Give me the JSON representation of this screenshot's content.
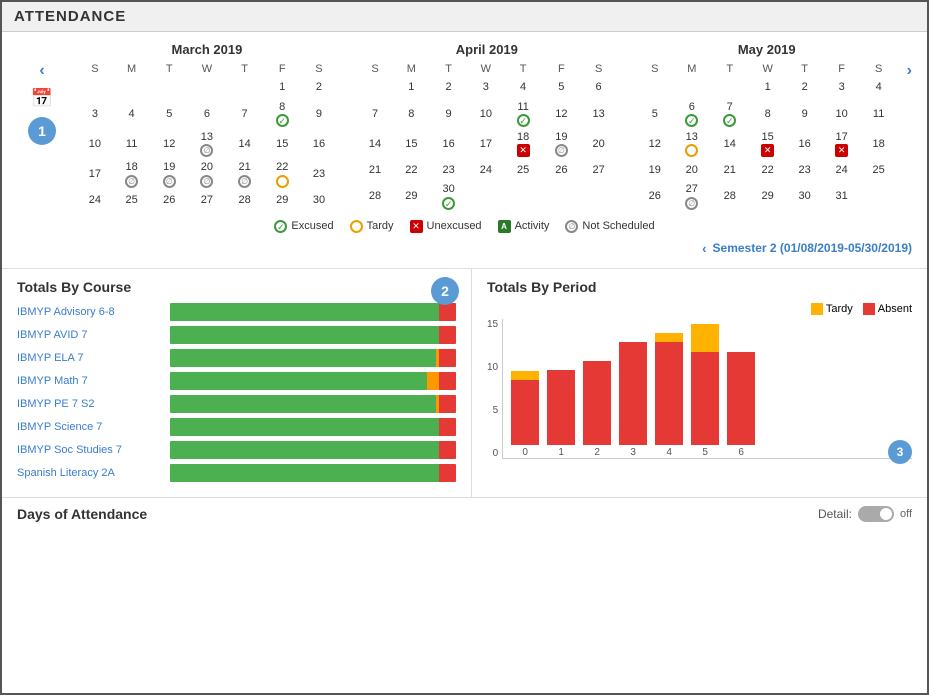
{
  "header": {
    "title": "ATTENDANCE"
  },
  "calendar": {
    "months": [
      {
        "title": "March 2019",
        "headers": [
          "S",
          "M",
          "T",
          "W",
          "T",
          "F",
          "S"
        ],
        "weeks": [
          [
            {
              "day": "",
              "other": true
            },
            {
              "day": "",
              "other": true
            },
            {
              "day": "",
              "other": true
            },
            {
              "day": "",
              "other": true
            },
            {
              "day": "",
              "other": true
            },
            {
              "day": "1"
            },
            {
              "day": "2"
            }
          ],
          [
            {
              "day": "3"
            },
            {
              "day": "4"
            },
            {
              "day": "5"
            },
            {
              "day": "6"
            },
            {
              "day": "7"
            },
            {
              "day": "8",
              "icon": "excused"
            },
            {
              "day": "9"
            }
          ],
          [
            {
              "day": "10"
            },
            {
              "day": "11"
            },
            {
              "day": "12"
            },
            {
              "day": "13",
              "icon": "notscheduled"
            },
            {
              "day": "14"
            },
            {
              "day": "15"
            },
            {
              "day": "16"
            }
          ],
          [
            {
              "day": "17"
            },
            {
              "day": "18",
              "icon": "notscheduled"
            },
            {
              "day": "19",
              "icon": "notscheduled"
            },
            {
              "day": "20",
              "icon": "notscheduled"
            },
            {
              "day": "21",
              "icon": "notscheduled"
            },
            {
              "day": "22",
              "icon": "tardy"
            },
            {
              "day": "23"
            }
          ],
          [
            {
              "day": "24"
            },
            {
              "day": "25"
            },
            {
              "day": "26"
            },
            {
              "day": "27"
            },
            {
              "day": "28"
            },
            {
              "day": "29"
            },
            {
              "day": "30"
            }
          ]
        ]
      },
      {
        "title": "April 2019",
        "headers": [
          "S",
          "M",
          "T",
          "W",
          "T",
          "F",
          "S"
        ],
        "weeks": [
          [
            {
              "day": "",
              "other": true
            },
            {
              "day": "1"
            },
            {
              "day": "2"
            },
            {
              "day": "3"
            },
            {
              "day": "4"
            },
            {
              "day": "5"
            },
            {
              "day": "6"
            }
          ],
          [
            {
              "day": "7"
            },
            {
              "day": "8"
            },
            {
              "day": "9"
            },
            {
              "day": "10"
            },
            {
              "day": "11",
              "icon": "excused"
            },
            {
              "day": "12"
            },
            {
              "day": "13"
            }
          ],
          [
            {
              "day": "14"
            },
            {
              "day": "15"
            },
            {
              "day": "16"
            },
            {
              "day": "17"
            },
            {
              "day": "18",
              "icon": "unexcused"
            },
            {
              "day": "19",
              "icon": "notscheduled"
            },
            {
              "day": "20"
            }
          ],
          [
            {
              "day": "21"
            },
            {
              "day": "22"
            },
            {
              "day": "23"
            },
            {
              "day": "24"
            },
            {
              "day": "25"
            },
            {
              "day": "26"
            },
            {
              "day": "27"
            }
          ],
          [
            {
              "day": "28"
            },
            {
              "day": "29"
            },
            {
              "day": "30",
              "icon": "excused"
            },
            {
              "day": "",
              "other": true
            },
            {
              "day": "",
              "other": true
            },
            {
              "day": "",
              "other": true
            },
            {
              "day": "",
              "other": true
            }
          ]
        ]
      },
      {
        "title": "May 2019",
        "headers": [
          "S",
          "M",
          "T",
          "W",
          "T",
          "F",
          "S"
        ],
        "weeks": [
          [
            {
              "day": "",
              "other": true
            },
            {
              "day": "",
              "other": true
            },
            {
              "day": "",
              "other": true
            },
            {
              "day": "1"
            },
            {
              "day": "2"
            },
            {
              "day": "3"
            },
            {
              "day": "4"
            }
          ],
          [
            {
              "day": "5"
            },
            {
              "day": "6",
              "icon": "excused"
            },
            {
              "day": "7",
              "icon": "excused"
            },
            {
              "day": "8"
            },
            {
              "day": "9"
            },
            {
              "day": "10"
            },
            {
              "day": "11"
            }
          ],
          [
            {
              "day": "12"
            },
            {
              "day": "13",
              "icon": "tardy"
            },
            {
              "day": "14"
            },
            {
              "day": "15",
              "icon": "unexcused"
            },
            {
              "day": "16"
            },
            {
              "day": "17",
              "icon": "unexcused"
            },
            {
              "day": "18"
            }
          ],
          [
            {
              "day": "19"
            },
            {
              "day": "20"
            },
            {
              "day": "21"
            },
            {
              "day": "22"
            },
            {
              "day": "23"
            },
            {
              "day": "24"
            },
            {
              "day": "25"
            }
          ],
          [
            {
              "day": "26"
            },
            {
              "day": "27",
              "icon": "notscheduled"
            },
            {
              "day": "28"
            },
            {
              "day": "29"
            },
            {
              "day": "30"
            },
            {
              "day": "31"
            },
            {
              "day": "",
              "other": true
            }
          ]
        ]
      }
    ],
    "legend": [
      {
        "label": "Excused",
        "type": "excused"
      },
      {
        "label": "Tardy",
        "type": "tardy"
      },
      {
        "label": "Unexcused",
        "type": "unexcused"
      },
      {
        "label": "Activity",
        "type": "activity"
      },
      {
        "label": "Not Scheduled",
        "type": "notscheduled"
      }
    ],
    "semester": "Semester 2 (01/08/2019-05/30/2019)"
  },
  "totals_course": {
    "title": "Totals By Course",
    "badge": "2",
    "courses": [
      {
        "name": "IBMYP Advisory 6-8",
        "green": 94,
        "orange": 0,
        "red": 6
      },
      {
        "name": "IBMYP AVID 7",
        "green": 94,
        "orange": 0,
        "red": 6
      },
      {
        "name": "IBMYP ELA 7",
        "green": 93,
        "orange": 1,
        "red": 6
      },
      {
        "name": "IBMYP Math 7",
        "green": 90,
        "orange": 4,
        "red": 6
      },
      {
        "name": "IBMYP PE 7 S2",
        "green": 93,
        "orange": 1,
        "red": 6
      },
      {
        "name": "IBMYP Science 7",
        "green": 94,
        "orange": 0,
        "red": 6
      },
      {
        "name": "IBMYP Soc Studies 7",
        "green": 94,
        "orange": 0,
        "red": 6
      },
      {
        "name": "Spanish Literacy 2A",
        "green": 94,
        "orange": 0,
        "red": 6
      }
    ]
  },
  "totals_period": {
    "title": "Totals By Period",
    "legend": [
      {
        "label": "Tardy",
        "color": "#ffb300"
      },
      {
        "label": "Absent",
        "color": "#e53935"
      }
    ],
    "bars": [
      {
        "period": "0",
        "tardy": 1,
        "absent": 7
      },
      {
        "period": "1",
        "tardy": 0,
        "absent": 8
      },
      {
        "period": "2",
        "tardy": 0,
        "absent": 9
      },
      {
        "period": "3",
        "tardy": 0,
        "absent": 11
      },
      {
        "period": "4",
        "tardy": 1,
        "absent": 11
      },
      {
        "period": "5",
        "tardy": 3,
        "absent": 10
      },
      {
        "period": "6",
        "tardy": 0,
        "absent": 10
      }
    ],
    "y_labels": [
      "",
      "5",
      "",
      "10",
      ""
    ],
    "badge": "3"
  },
  "days_attendance": {
    "title": "Days of Attendance",
    "detail_label": "Detail:",
    "toggle_state": "off"
  },
  "nav": {
    "prev_arrow": "‹",
    "next_arrow": "›"
  }
}
